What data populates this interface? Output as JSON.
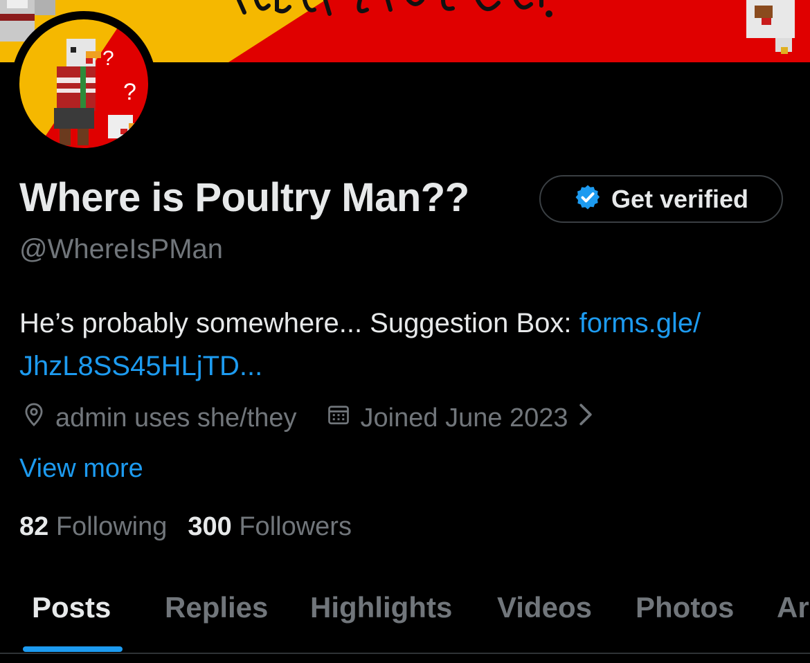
{
  "banner": {
    "title_fragment": "Poultry Man??"
  },
  "profile": {
    "display_name": "Where is Poultry Man??",
    "handle": "@WhereIsPMan",
    "bio_text": "He’s probably somewhere... Suggestion Box: ",
    "bio_link": "forms.gle/​JhzL8SS45HLjTD..."
  },
  "verify_button": {
    "label": "Get verified"
  },
  "meta": {
    "location": "admin uses she/they",
    "joined": "Joined June 2023"
  },
  "view_more": "View more",
  "stats": {
    "following_count": "82",
    "following_label": "Following",
    "followers_count": "300",
    "followers_label": "Followers"
  },
  "tabs": [
    {
      "label": "Posts",
      "active": true
    },
    {
      "label": "Replies"
    },
    {
      "label": "Highlights"
    },
    {
      "label": "Videos"
    },
    {
      "label": "Photos"
    },
    {
      "label": "Ar"
    }
  ],
  "colors": {
    "accent": "#1d9bf0",
    "banner_yellow": "#f5b800",
    "banner_red": "#e00000"
  }
}
